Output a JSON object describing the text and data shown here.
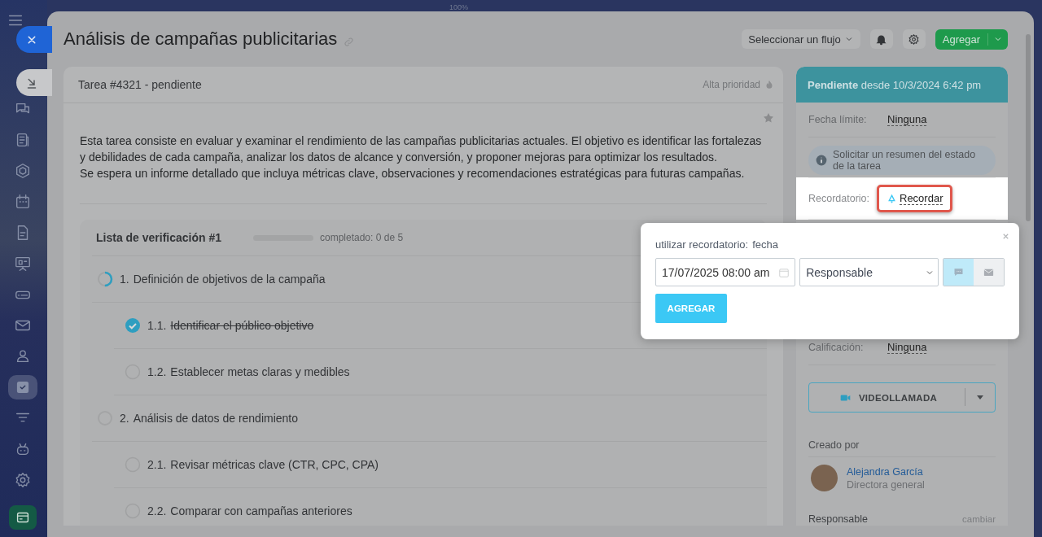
{
  "zoom_label": "100%",
  "sidebar": {
    "items": [
      {
        "selected": false
      },
      {
        "selected": false
      },
      {
        "selected": false
      },
      {
        "selected": false
      },
      {
        "selected": false
      },
      {
        "selected": false
      },
      {
        "selected": false
      },
      {
        "selected": false
      },
      {
        "selected": false
      },
      {
        "selected": true
      },
      {
        "selected": false
      },
      {
        "selected": false
      },
      {
        "selected": false
      }
    ]
  },
  "title": "Análisis de campañas publicitarias",
  "header": {
    "flow_select": "Seleccionar un flujo",
    "add_button": "Agregar"
  },
  "task": {
    "heading": "Tarea #4321 - pendiente",
    "priority": "Alta prioridad",
    "starred": false,
    "description": [
      "Esta tarea consiste en evaluar y examinar el rendimiento de las campañas publicitarias actuales. El objetivo es identificar las fortalezas y debilidades de cada campaña, analizar los datos de alcance y conversión, y proponer mejoras para optimizar los resultados.",
      "Se espera un informe detallado que incluya métricas clave, observaciones y recomendaciones estratégicas para futuras campañas."
    ]
  },
  "checklist": {
    "title": "Lista de verificación #1",
    "level": 0,
    "progress_text": "completado: 0 de 5",
    "items": [
      {
        "number": "1.",
        "label": "Definición de objetivos de la campaña",
        "level": 0.5,
        "children": [
          {
            "number": "1.1.",
            "label": "Identificar el público objetivo",
            "checked": true
          },
          {
            "number": "1.2.",
            "label": "Establecer metas claras y medibles",
            "checked": false
          }
        ]
      },
      {
        "number": "2.",
        "label": "Análisis de datos de rendimiento",
        "level": 0,
        "children": [
          {
            "number": "2.1.",
            "label": "Revisar métricas clave (CTR, CPC, CPA)",
            "checked": false
          },
          {
            "number": "2.2.",
            "label": "Comparar con campañas anteriores",
            "checked": false
          }
        ]
      }
    ]
  },
  "status": {
    "state": "Pendiente",
    "since": "desde 10/3/2024 6:42 pm"
  },
  "deadline": {
    "label": "Fecha límite:",
    "value": "Ninguna"
  },
  "summary_button": "Solicitar un resumen del estado de la tarea",
  "reminder": {
    "label": "Recordatorio:",
    "button": "Recordar"
  },
  "rating": {
    "label": "Calificación:",
    "value": "Ninguna"
  },
  "video_button": "VIDEOLLAMADA",
  "created_by": {
    "heading": "Creado por",
    "name": "Alejandra García",
    "role": "Directora general"
  },
  "responsible": {
    "heading": "Responsable",
    "action": "cambiar"
  },
  "reminder_popup": {
    "label": "utilizar recordatorio:",
    "mode": "fecha",
    "date": "17/07/2025 08:00 am",
    "recipient": "Responsable",
    "channels": [
      {
        "kind": "chat",
        "selected": true
      },
      {
        "kind": "mail",
        "selected": false
      }
    ],
    "submit": "AGREGAR"
  }
}
